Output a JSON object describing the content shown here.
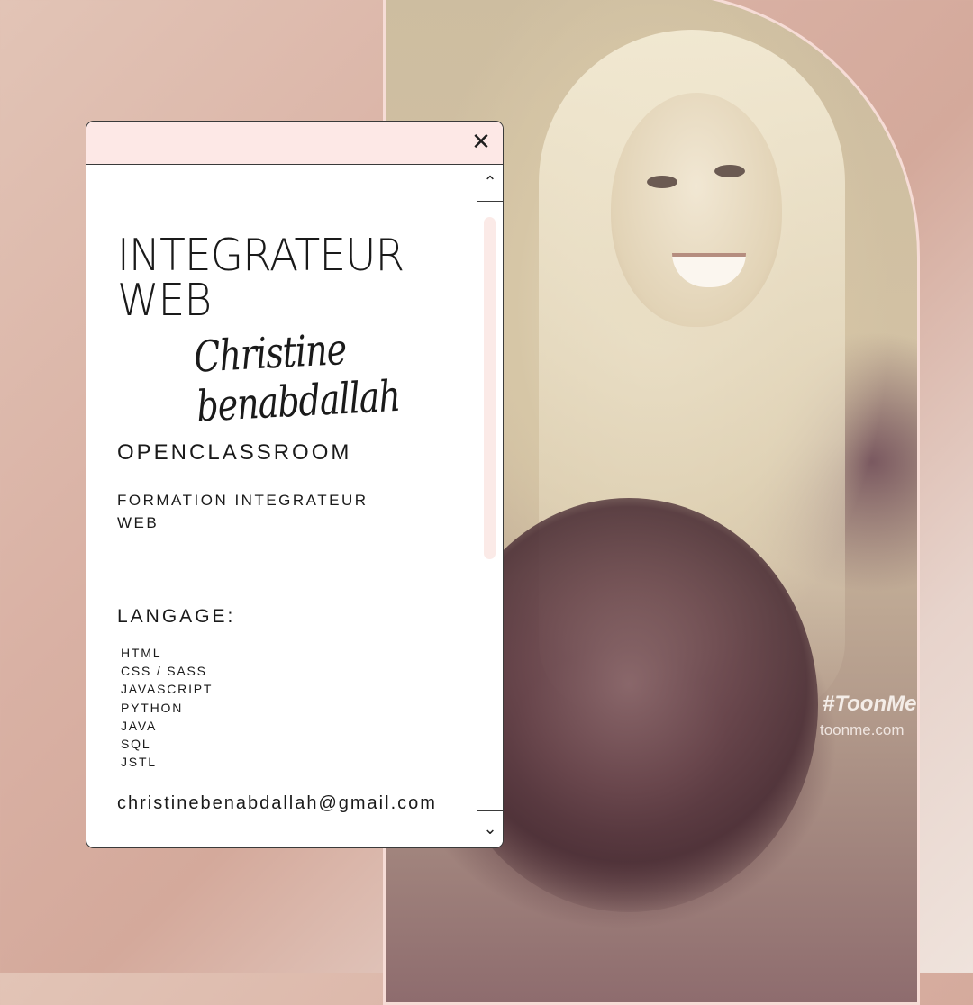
{
  "window": {
    "close_icon": "close-icon",
    "scroll_up_icon": "chevron-up-icon",
    "scroll_down_icon": "chevron-down-icon"
  },
  "profile": {
    "title_line1": "INTEGRATEUR",
    "title_line2": "WEB",
    "signature": "Christine benabdallah",
    "school": "OPENCLASSROOM",
    "training": "FORMATION INTEGRATEUR WEB",
    "languages_title": "LANGAGE:",
    "languages": [
      "HTML",
      "CSS / SASS",
      "JAVASCRIPT",
      "PYTHON",
      "JAVA",
      "SQL",
      "JSTL"
    ],
    "email": "christinebenabdallah@gmail.com"
  },
  "photo": {
    "watermark_tag": "#ToonMe",
    "watermark_url": "toonme.com"
  },
  "colors": {
    "titlebar": "#fde8e6",
    "scroll_thumb": "#fbeae7",
    "background": "#d9b1a4"
  }
}
